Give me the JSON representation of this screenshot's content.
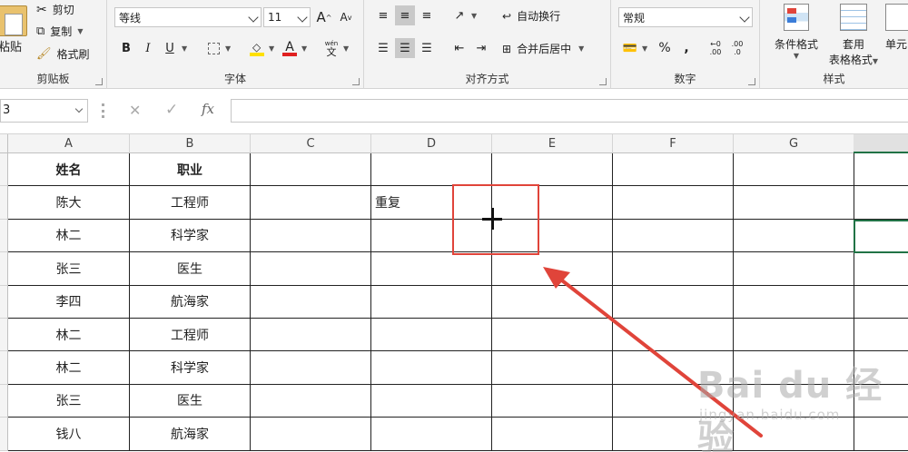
{
  "ribbon": {
    "clipboard": {
      "label": "剪贴板",
      "paste": "粘贴",
      "cut": "剪切",
      "copy": "复制",
      "format_painter": "格式刷"
    },
    "font": {
      "label": "字体",
      "font_name": "等线",
      "font_size": "11",
      "bold": "B",
      "italic": "I",
      "underline": "U",
      "font_color_letter": "A",
      "grow_letter": "A",
      "shrink_letter": "A",
      "phonetic": "wén",
      "phonetic_char": "文",
      "font_color": "#e02020",
      "fill_color": "#ffe000"
    },
    "alignment": {
      "label": "对齐方式",
      "wrap_text": "自动换行",
      "merge_center": "合并后居中"
    },
    "number": {
      "label": "数字",
      "format": "常规",
      "percent": "%",
      "comma": ",",
      "inc_decimal": ".00",
      "dec_decimal": ".0"
    },
    "styles": {
      "label": "样式",
      "conditional_format": "条件格式",
      "format_as_table_1": "套用",
      "format_as_table_2": "表格格式",
      "cell_styles": "单元"
    }
  },
  "formula_bar": {
    "name_box": "3",
    "cancel": "✕",
    "enter": "✓",
    "fx": "fx",
    "content": ""
  },
  "columns": [
    "A",
    "B",
    "C",
    "D",
    "E",
    "F",
    "G"
  ],
  "rows": [
    [
      "姓名",
      "职业",
      "",
      "",
      "",
      "",
      ""
    ],
    [
      "陈大",
      "工程师",
      "",
      "重复",
      "",
      "",
      ""
    ],
    [
      "林二",
      "科学家",
      "",
      "",
      "",
      "",
      ""
    ],
    [
      "张三",
      "医生",
      "",
      "",
      "",
      "",
      ""
    ],
    [
      "李四",
      "航海家",
      "",
      "",
      "",
      "",
      ""
    ],
    [
      "林二",
      "工程师",
      "",
      "",
      "",
      "",
      ""
    ],
    [
      "林二",
      "科学家",
      "",
      "",
      "",
      "",
      ""
    ],
    [
      "张三",
      "医生",
      "",
      "",
      "",
      "",
      ""
    ],
    [
      "钱八",
      "航海家",
      "",
      "",
      "",
      "",
      ""
    ]
  ],
  "annotation": {
    "color": "#e0443a"
  },
  "watermark": {
    "main": "Bai du 经验",
    "sub": "jingyan.baidu.com"
  }
}
